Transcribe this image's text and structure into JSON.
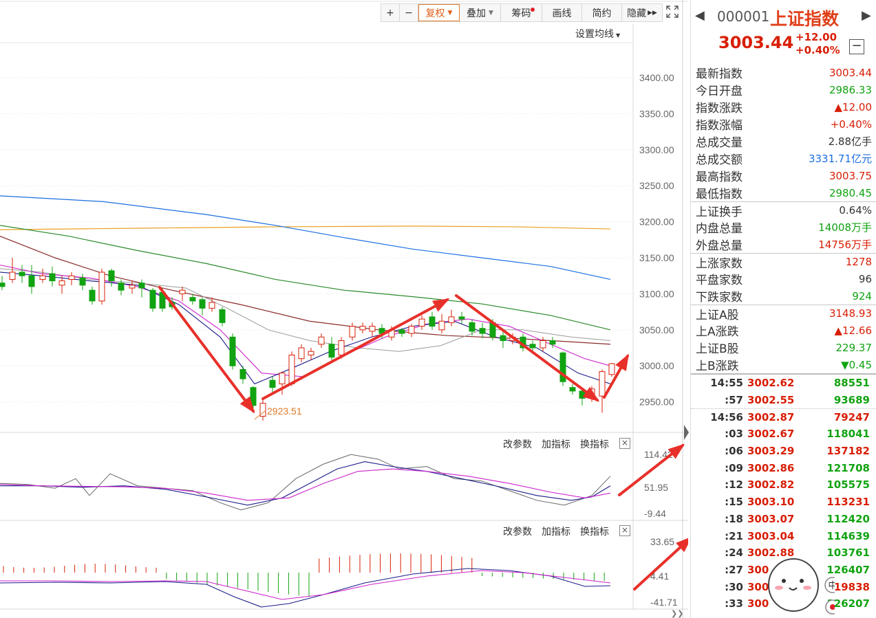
{
  "toolbar": {
    "plus": "+",
    "minus": "−",
    "fuquan": "复权",
    "diejia": "叠加",
    "chouma": "筹码",
    "huaxian": "画线",
    "jianyue": "简约",
    "yincang": "隐藏"
  },
  "set_ma": "设置均线",
  "price_axis": [
    "3400.00",
    "3350.00",
    "3300.00",
    "3250.00",
    "3200.00",
    "3150.00",
    "3100.00",
    "3050.00",
    "3000.00",
    "2950.00"
  ],
  "low_annotation": "2923.51",
  "panel1": {
    "gaicanshu": "改参数",
    "jiazhibiao": "加指标",
    "huanzhibiao": "换指标",
    "close": "×",
    "axis": [
      "114.42",
      "51.95",
      "-9.44"
    ]
  },
  "panel2": {
    "gaicanshu": "改参数",
    "jiazhibiao": "加指标",
    "huanzhibiao": "换指标",
    "close": "×",
    "axis": [
      "33.65",
      "4.41",
      "-41.71"
    ]
  },
  "quote": {
    "code": "000001",
    "name": "上证指数",
    "price": "3003.44",
    "change": "+12.00",
    "change_pct": "+0.40%",
    "collapse": "−"
  },
  "stats": [
    {
      "label": "最新指数",
      "value": "3003.44",
      "color": "c-red"
    },
    {
      "label": "今日开盘",
      "value": "2986.33",
      "color": "c-green"
    },
    {
      "label": "指数涨跌",
      "value": "▲12.00",
      "color": "c-red"
    },
    {
      "label": "指数涨幅",
      "value": "+0.40%",
      "color": "c-red"
    },
    {
      "label": "总成交量",
      "value": "2.88亿手",
      "color": "c-dark"
    },
    {
      "label": "总成交额",
      "value": "3331.71亿元",
      "color": "c-blue"
    },
    {
      "label": "最高指数",
      "value": "3003.75",
      "color": "c-red"
    },
    {
      "label": "最低指数",
      "value": "2980.45",
      "color": "c-green"
    },
    {
      "label": "上证换手",
      "value": "0.64%",
      "color": "c-dark",
      "sep": true
    },
    {
      "label": "内盘总量",
      "value": "14008万手",
      "color": "c-green"
    },
    {
      "label": "外盘总量",
      "value": "14756万手",
      "color": "c-red"
    },
    {
      "label": "上涨家数",
      "value": "1278",
      "color": "c-red",
      "sep": true
    },
    {
      "label": "平盘家数",
      "value": "96",
      "color": "c-dark"
    },
    {
      "label": "下跌家数",
      "value": "924",
      "color": "c-green"
    },
    {
      "label": "上证A股",
      "value": "3148.93",
      "color": "c-red",
      "sep": true
    },
    {
      "label": "上A涨跌",
      "value": "▲12.66",
      "color": "c-red"
    },
    {
      "label": "上证B股",
      "value": "229.37",
      "color": "c-green"
    },
    {
      "label": "上B涨跌",
      "value": "▼0.45",
      "color": "c-green"
    }
  ],
  "ticks": [
    {
      "time": "14:55",
      "price": "3002.62",
      "vol": "88551",
      "vcolor": "c-green"
    },
    {
      "time": ":57",
      "price": "3002.55",
      "vol": "93689",
      "vcolor": "c-green"
    },
    {
      "time": "14:56",
      "price": "3002.87",
      "vol": "79247",
      "vcolor": "c-red",
      "sep": true
    },
    {
      "time": ":03",
      "price": "3002.67",
      "vol": "118041",
      "vcolor": "c-green"
    },
    {
      "time": ":06",
      "price": "3003.29",
      "vol": "137182",
      "vcolor": "c-red"
    },
    {
      "time": ":09",
      "price": "3002.86",
      "vol": "121708",
      "vcolor": "c-green"
    },
    {
      "time": ":12",
      "price": "3002.82",
      "vol": "105575",
      "vcolor": "c-green"
    },
    {
      "time": ":15",
      "price": "3003.10",
      "vol": "113231",
      "vcolor": "c-red"
    },
    {
      "time": ":18",
      "price": "3003.07",
      "vol": "112420",
      "vcolor": "c-green"
    },
    {
      "time": ":21",
      "price": "3003.04",
      "vol": "114639",
      "vcolor": "c-green"
    },
    {
      "time": ":24",
      "price": "3002.88",
      "vol": "103761",
      "vcolor": "c-green"
    },
    {
      "time": ":27",
      "price": "300",
      "vol": "126407",
      "vcolor": "c-green"
    },
    {
      "time": ":30",
      "price": "300",
      "vol": "19838",
      "vcolor": "c-red"
    },
    {
      "time": ":33",
      "price": "300",
      "vol": "126207",
      "vcolor": "c-green"
    }
  ],
  "mascot_badge": "中",
  "colors": {
    "up": "#d81e06",
    "down": "#11a311",
    "arrow": "#e8302a",
    "ma_blue": "#1a6fe0",
    "ma_orange": "#e8a020",
    "ma_green": "#2a8a2a"
  }
}
